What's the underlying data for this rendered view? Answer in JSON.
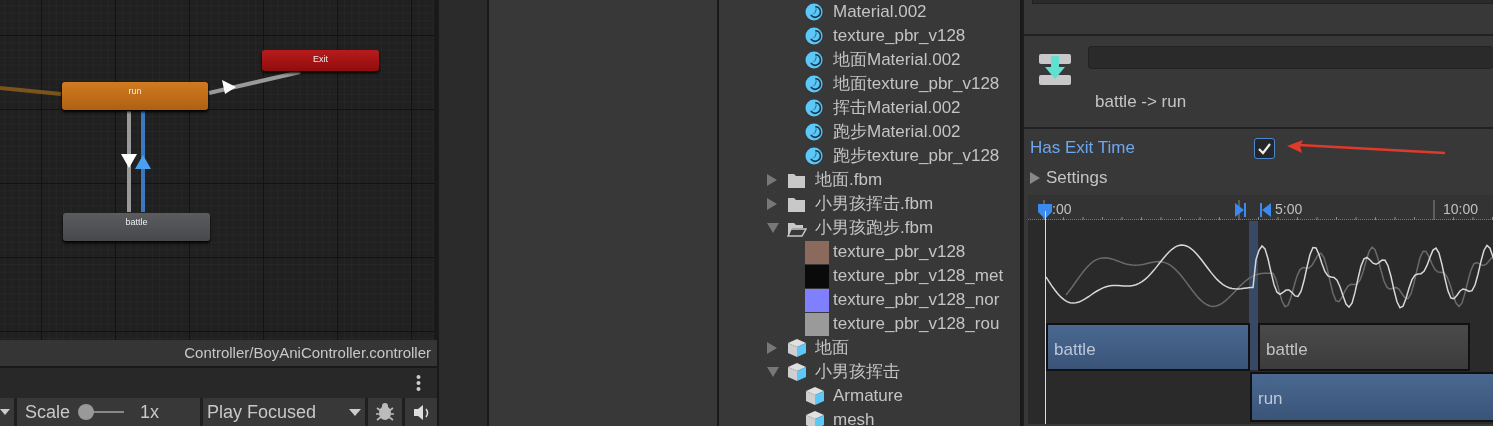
{
  "graph": {
    "nodes": [
      {
        "label": "run",
        "kind": "default_state"
      },
      {
        "label": "Exit",
        "kind": "exit"
      },
      {
        "label": "battle",
        "kind": "state"
      }
    ],
    "transitions": [
      {
        "selected": false
      },
      {
        "selected": false
      },
      {
        "selected": false
      },
      {
        "selected": true
      }
    ],
    "path": "Controller/BoyAniController.controller"
  },
  "bottom_bar": {
    "scale_label": "Scale",
    "scale_slider": {
      "level": 0
    },
    "scale_value": "1x",
    "play_mode": "Play Focused"
  },
  "project_tree": {
    "continued_items": [
      {
        "label": "Material.002",
        "kind": "material"
      },
      {
        "label": "texture_pbr_v128",
        "kind": "material"
      },
      {
        "label": "地面Material.002",
        "kind": "material"
      },
      {
        "label": "地面texture_pbr_v128",
        "kind": "material"
      },
      {
        "label": "挥击Material.002",
        "kind": "material"
      },
      {
        "label": "跑步Material.002",
        "kind": "material"
      },
      {
        "label": "跑步texture_pbr_v128",
        "kind": "material"
      }
    ],
    "items": [
      {
        "label": "地面.fbm",
        "kind": "folder",
        "expanded": false
      },
      {
        "label": "小男孩挥击.fbm",
        "kind": "folder",
        "expanded": false
      },
      {
        "label": "小男孩跑步.fbm",
        "kind": "folder",
        "expanded": true,
        "children": [
          {
            "label": "texture_pbr_v128",
            "kind": "texture",
            "color": "#8a6a5c"
          },
          {
            "label": "texture_pbr_v128_met",
            "kind": "texture",
            "color": "#0a0a0a"
          },
          {
            "label": "texture_pbr_v128_nor",
            "kind": "texture",
            "color": "#8080ff"
          },
          {
            "label": "texture_pbr_v128_rou",
            "kind": "texture",
            "color": "#9a9a9a"
          }
        ]
      },
      {
        "label": "地面",
        "kind": "model",
        "expanded": false
      },
      {
        "label": "小男孩挥击",
        "kind": "model",
        "expanded": true,
        "children": [
          {
            "label": "Armature",
            "kind": "model"
          },
          {
            "label": "mesh",
            "kind": "model"
          }
        ]
      }
    ]
  },
  "inspector": {
    "transition_label": "battle -> run",
    "has_exit_time": {
      "label": "Has Exit Time",
      "checked": true
    },
    "settings": {
      "label": "Settings",
      "expanded": false
    },
    "timeline": {
      "ticks": [
        ":00",
        "5:00",
        "10:00"
      ],
      "clips": [
        {
          "label": "battle",
          "selected": true
        },
        {
          "label": "battle",
          "selected": false
        },
        {
          "label": "run",
          "selected": true
        }
      ]
    }
  }
}
